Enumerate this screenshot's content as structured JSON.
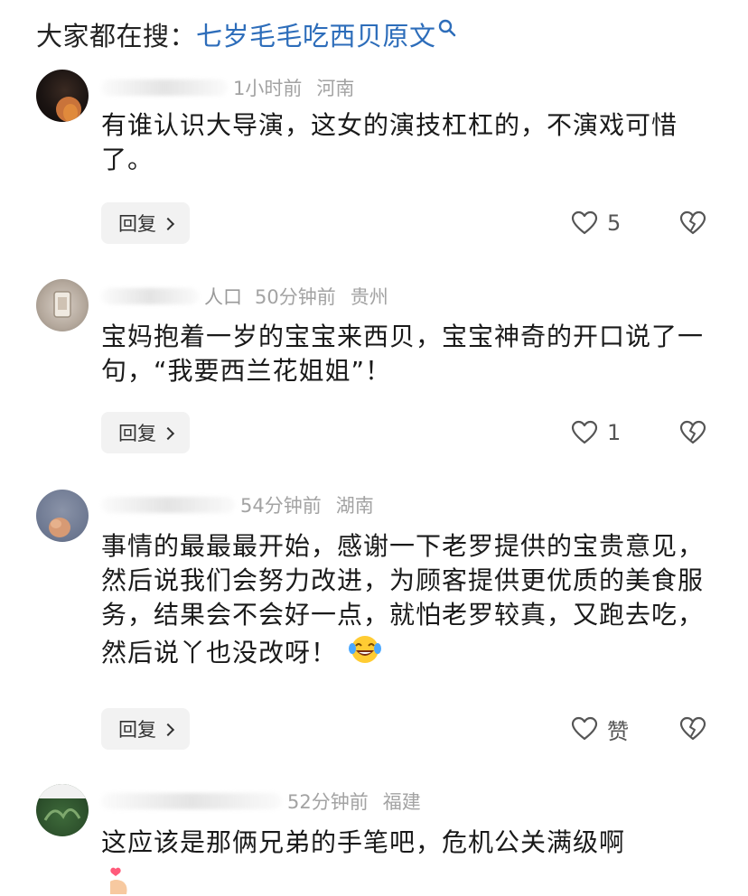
{
  "search": {
    "prefix": "大家都在搜：",
    "term": "七岁毛毛吃西贝原文"
  },
  "comments": [
    {
      "name": "",
      "time": "1小时前",
      "location": "河南",
      "text": "有谁认识大导演，这女的演技杠杠的，不演戏可惜了。",
      "reply_label": "回复",
      "likes": "5"
    },
    {
      "name": "人口",
      "time": "50分钟前",
      "location": "贵州",
      "text": "宝妈抱着一岁的宝宝来西贝，宝宝神奇的开口说了一句，“我要西兰花姐姐”！",
      "reply_label": "回复",
      "likes": "1"
    },
    {
      "name": "",
      "time": "54分钟前",
      "location": "湖南",
      "text": "事情的最最最开始，感谢一下老罗提供的宝贵意见，然后说我们会努力改进，为顾客提供更优质的美食服务，结果会不会好一点，就怕老罗较真，又跑去吃，然后说丫也没改呀！",
      "reply_label": "回复",
      "likes": "赞"
    },
    {
      "name": "",
      "time": "52分钟前",
      "location": "福建",
      "text": "这应该是那俩兄弟的手笔吧，危机公关满级啊"
    }
  ],
  "icons": {
    "search": "search-icon",
    "like": "heart-outline-icon",
    "dislike": "broken-heart-icon",
    "reply_chevron": "chevron-right-icon",
    "laugh_emoji": "tears-of-joy-emoji-icon",
    "heart_hand_emoji": "finger-heart-emoji-icon"
  },
  "colors": {
    "search_term": "#2d6dba",
    "meta": "#a3a3a3",
    "reply_bg": "#f2f2f2"
  }
}
